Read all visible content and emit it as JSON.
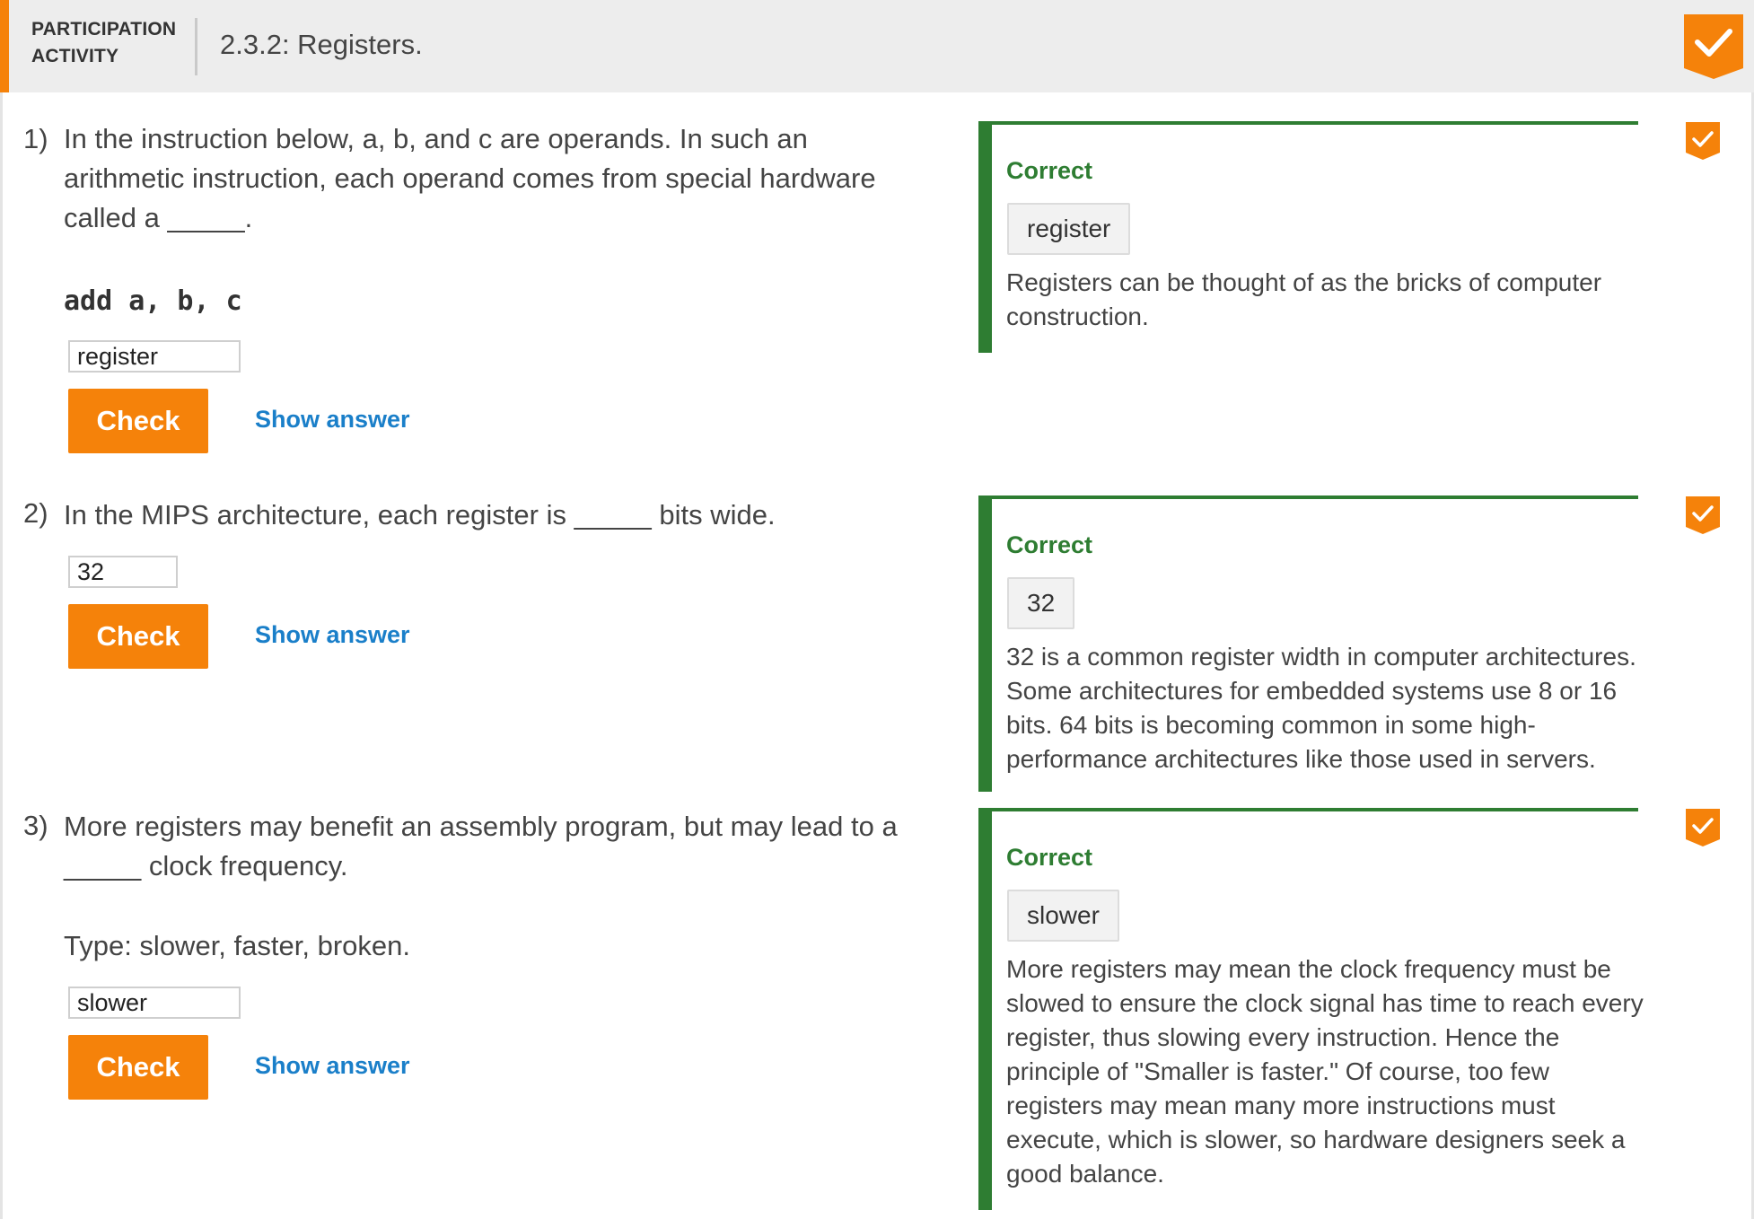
{
  "header": {
    "kind": "PARTICIPATION ACTIVITY",
    "title": "2.3.2: Registers."
  },
  "questions": [
    {
      "number": "1)",
      "text": "In the instruction below, a, b, and c are operands. In such an arithmetic instruction, each operand comes from special hardware called a _____.",
      "code": "add a, b, c",
      "input_value": "register",
      "check_label": "Check",
      "show_answer_label": "Show answer",
      "feedback": {
        "status": "Correct",
        "answer": "register",
        "explanation": "Registers can be thought of as the bricks of computer construction."
      }
    },
    {
      "number": "2)",
      "text": "In the MIPS architecture, each register is _____ bits wide.",
      "input_value": "32",
      "check_label": "Check",
      "show_answer_label": "Show answer",
      "feedback": {
        "status": "Correct",
        "answer": "32",
        "explanation": "32 is a common register width in computer architectures. Some architectures for embedded systems use 8 or 16 bits. 64 bits is becoming common in some high-performance architectures like those used in servers."
      }
    },
    {
      "number": "3)",
      "text": "More registers may benefit an assembly program, but may lead to a _____ clock frequency.",
      "hint": "Type: slower, faster, broken.",
      "input_value": "slower",
      "check_label": "Check",
      "show_answer_label": "Show answer",
      "feedback": {
        "status": "Correct",
        "answer": "slower",
        "explanation": "More registers may mean the clock frequency must be slowed to ensure the clock signal has time to reach every register, thus slowing every instruction. Hence the principle of \"Smaller is faster.\" Of course, too few registers may mean many more instructions must execute, which is slower, so hardware designers seek a good balance."
      }
    }
  ],
  "colors": {
    "accent": "#f5820a",
    "correct": "#2e7d32",
    "link": "#1a7fc9",
    "header_bg": "#ededed"
  },
  "icons": {
    "activity_complete": "checkmark-badge-icon",
    "question_complete": "checkmark-badge-icon"
  }
}
